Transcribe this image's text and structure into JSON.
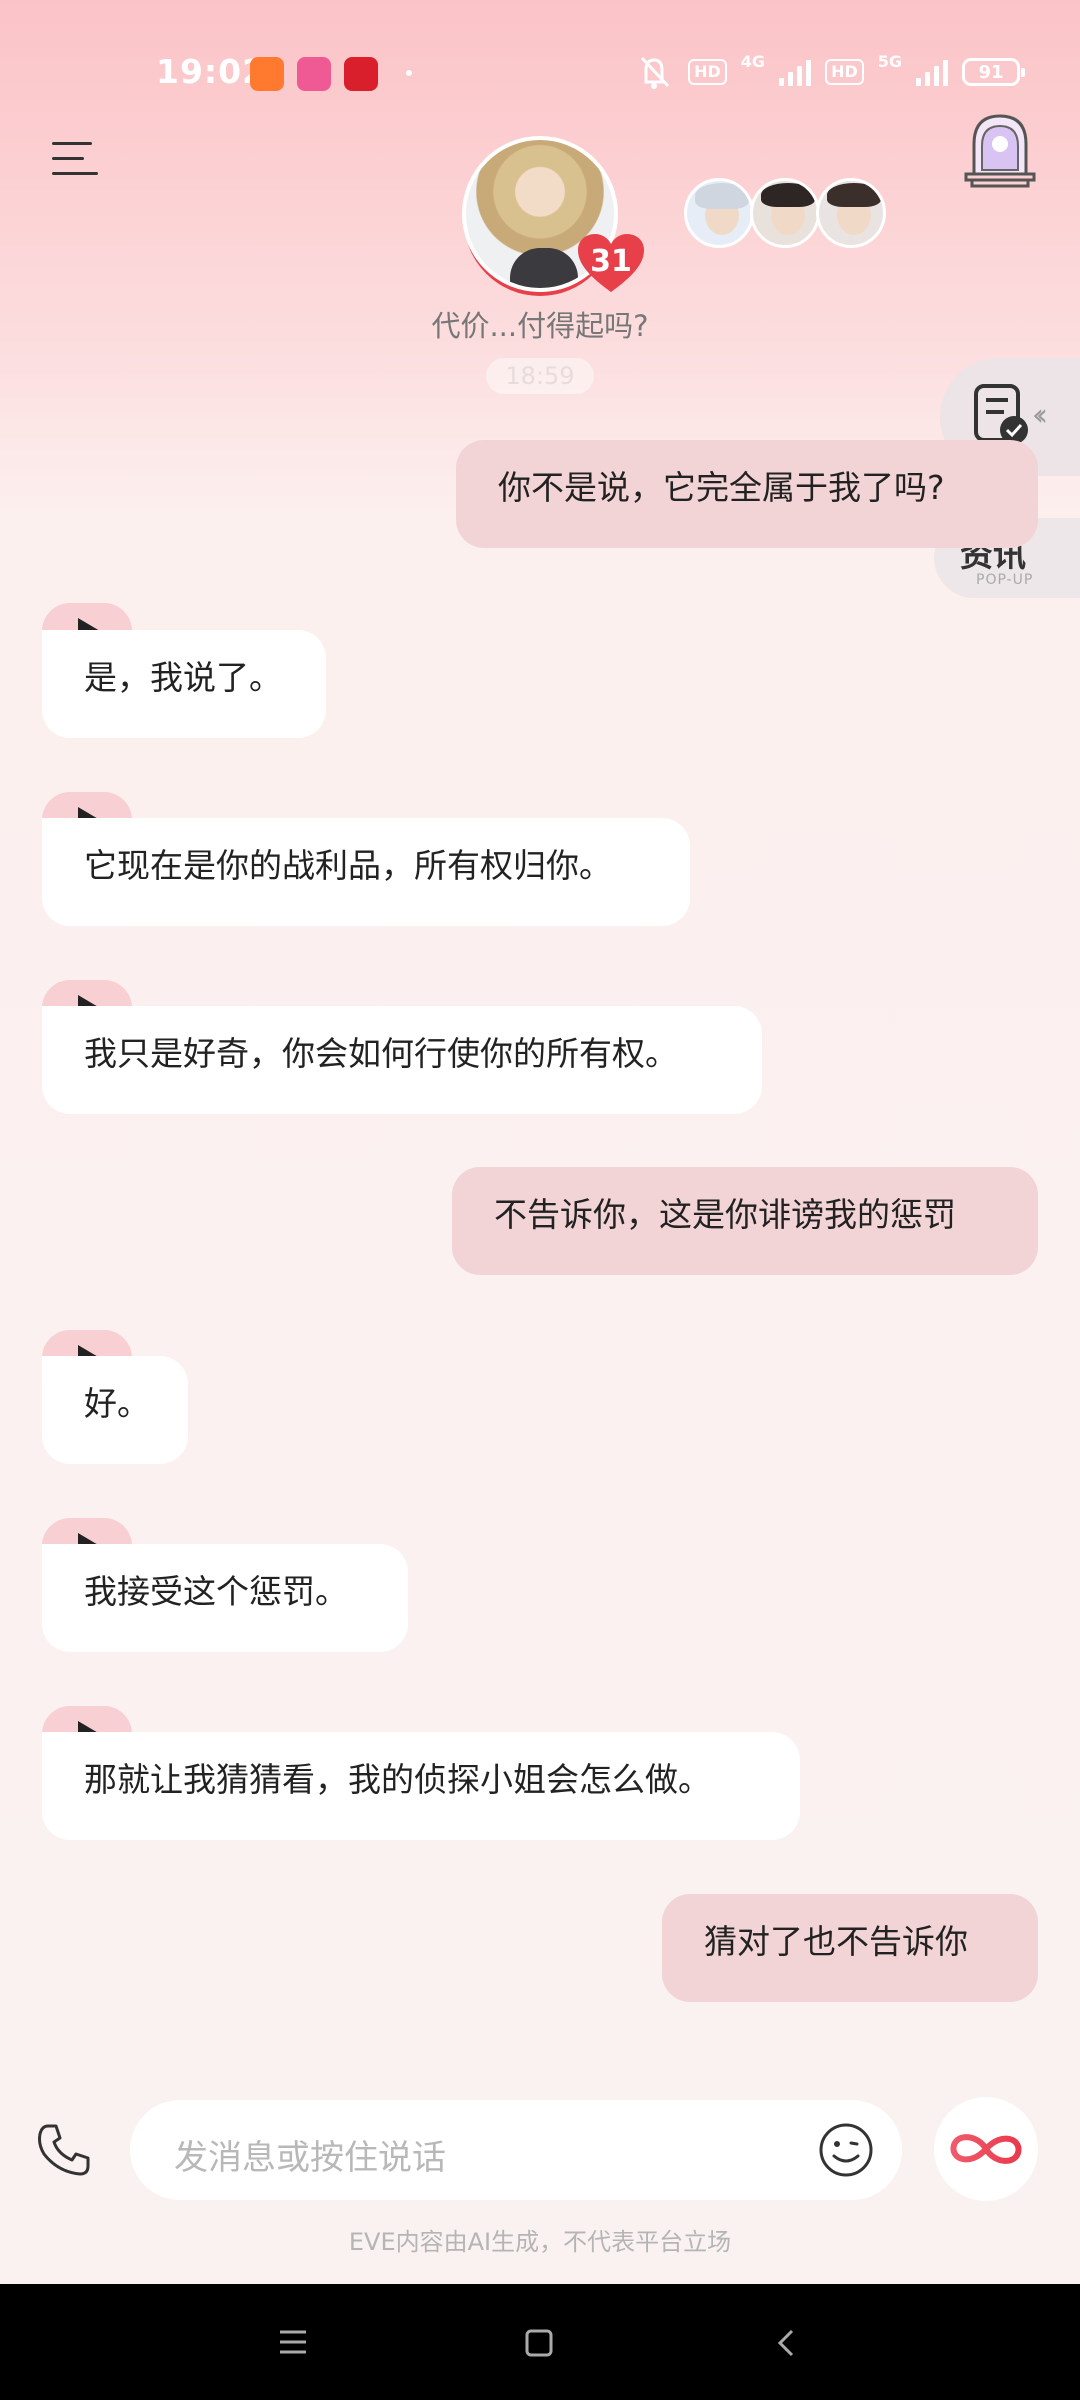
{
  "status_bar": {
    "time": "19:02",
    "network_1": "4G",
    "network_2": "5G",
    "hd_1": "HD",
    "hd_2": "HD",
    "battery": "91"
  },
  "header": {
    "character_badge": "31",
    "subtitle": "代价...付得起吗?",
    "faded_timestamp": "18:59"
  },
  "side_panel": {
    "news_label": "资讯",
    "news_sub": "POP-UP"
  },
  "messages": [
    {
      "role": "user",
      "text": "你不是说，它完全属于我了吗?"
    },
    {
      "role": "ai",
      "text": "是，我说了。"
    },
    {
      "role": "ai",
      "text": "它现在是你的战利品，所有权归你。"
    },
    {
      "role": "ai",
      "text": "我只是好奇，你会如何行使你的所有权。"
    },
    {
      "role": "user",
      "text": "不告诉你，这是你诽谤我的惩罚"
    },
    {
      "role": "ai",
      "text": "好。"
    },
    {
      "role": "ai",
      "text": "我接受这个惩罚。"
    },
    {
      "role": "ai",
      "text": "那就让我猜猜看，我的侦探小姐会怎么做。"
    },
    {
      "role": "user",
      "text": "猜对了也不告诉你"
    }
  ],
  "composer": {
    "placeholder": "发消息或按住说话"
  },
  "footer": {
    "disclaimer": "EVE内容由AI生成，不代表平台立场"
  },
  "colors": {
    "accent": "#e8404a",
    "user_bubble": "#f2d4d6",
    "ai_bubble": "#ffffff",
    "play_tab": "#f8cfd2"
  }
}
